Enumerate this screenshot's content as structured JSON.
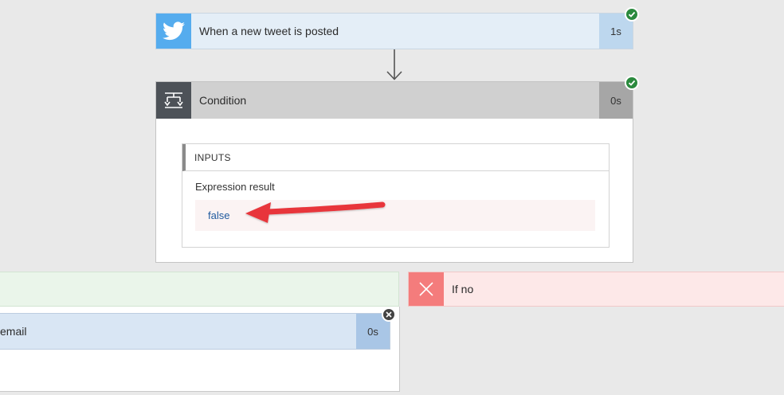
{
  "trigger": {
    "label": "When a new tweet is posted",
    "duration": "1s",
    "icon": "twitter-icon",
    "status": "succeeded"
  },
  "condition": {
    "label": "Condition",
    "duration": "0s",
    "icon": "condition-icon",
    "status": "succeeded",
    "inputs": {
      "header": "INPUTS",
      "field_label": "Expression result",
      "field_value": "false"
    }
  },
  "branch_yes": {
    "action_label": "email",
    "action_duration": "0s",
    "status": "skipped"
  },
  "branch_no": {
    "label": "If no",
    "icon": "close-icon"
  },
  "colors": {
    "twitter_blue": "#55acee",
    "success_green": "#2b8a3e",
    "no_branch_red": "#f47c7c",
    "arrow_red": "#e8343b",
    "link_blue": "#1f5a9e"
  }
}
